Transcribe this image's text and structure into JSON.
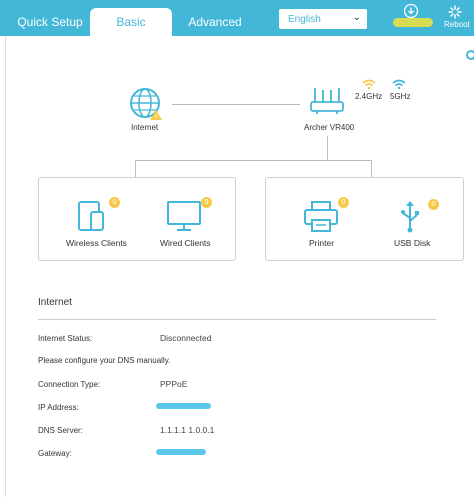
{
  "tabs": {
    "quick_setup": "Quick Setup",
    "basic": "Basic",
    "advanced": "Advanced"
  },
  "language": {
    "selected": "English"
  },
  "reboot": {
    "label": "Reboot"
  },
  "topology": {
    "internet_label": "Internet",
    "router_label": "Archer VR400",
    "band_24": "2.4GHz",
    "band_5": "5GHz"
  },
  "devices": [
    {
      "label": "Wireless Clients",
      "count": "0"
    },
    {
      "label": "Wired Clients",
      "count": "0"
    },
    {
      "label": "Printer",
      "count": "0"
    },
    {
      "label": "USB Disk",
      "count": "0"
    }
  ],
  "internet_section": {
    "title": "Internet",
    "status_key": "Internet Status:",
    "status_value": "Disconnected",
    "dns_notice": "Please configure your DNS manually.",
    "conn_type_key": "Connection Type:",
    "conn_type_value": "PPPoE",
    "ip_key": "IP Address:",
    "dns_key": "DNS Server:",
    "dns_value": "1.1.1.1 1.0.0.1",
    "gateway_key": "Gateway:"
  },
  "colors": {
    "accent": "#43b7d8",
    "badge": "#f7c948",
    "redaction": "#5bc8ea",
    "highlighter": "#f3e33a"
  }
}
